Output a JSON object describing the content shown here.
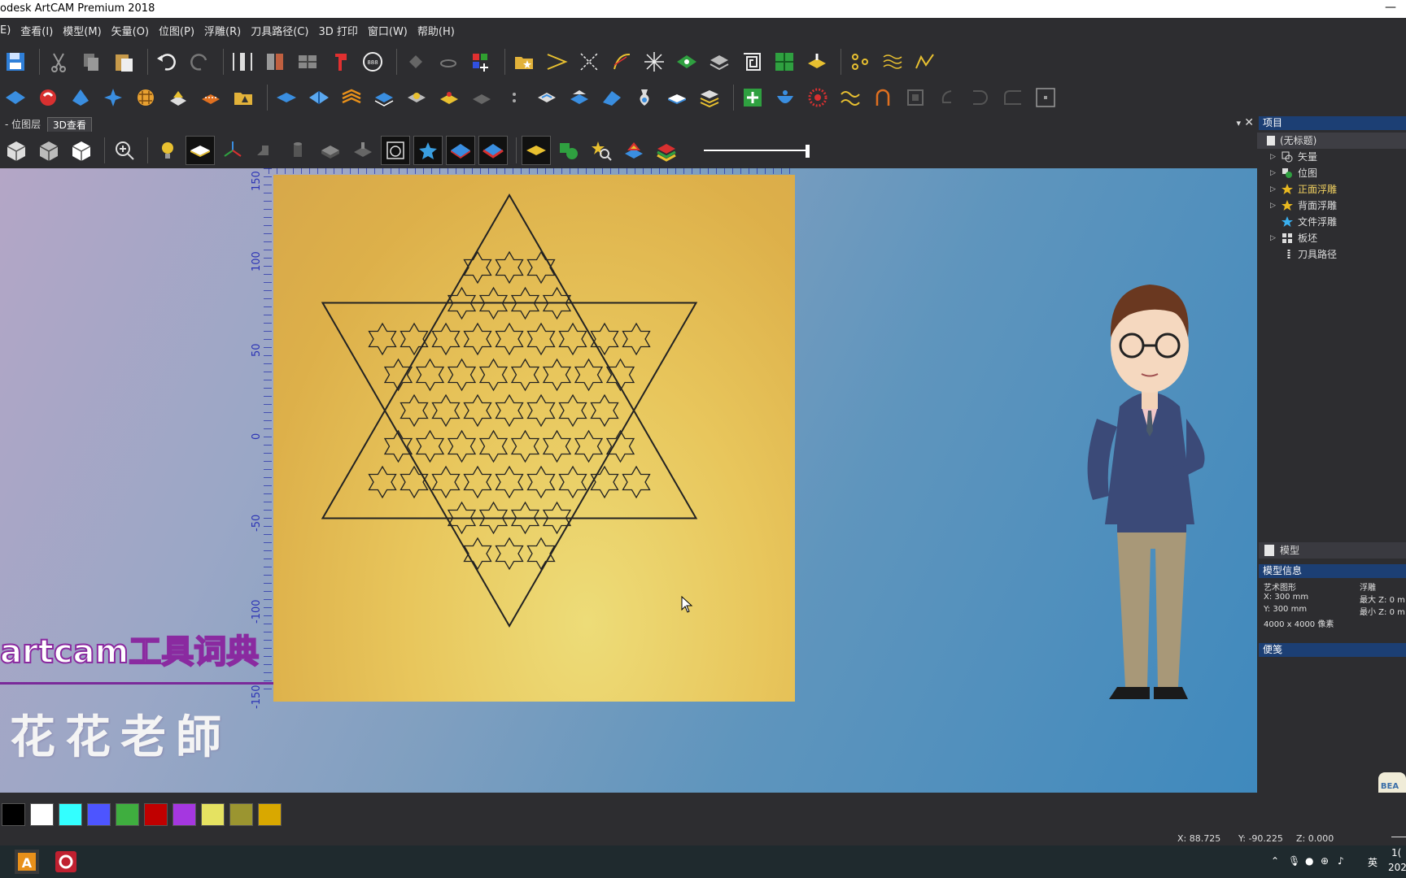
{
  "window": {
    "title": "odesk ArtCAM Premium 2018",
    "minimize": "—"
  },
  "menu": [
    {
      "label": "E)"
    },
    {
      "label": "查看(I)"
    },
    {
      "label": "模型(M)"
    },
    {
      "label": "矢量(O)"
    },
    {
      "label": "位图(P)"
    },
    {
      "label": "浮雕(R)"
    },
    {
      "label": "刀具路径(C)"
    },
    {
      "label": "3D 打印"
    },
    {
      "label": "窗口(W)"
    },
    {
      "label": "帮助(H)"
    }
  ],
  "tabs": {
    "bitmap_layer": "- 位图层",
    "view3d": "3D查看",
    "dropdown": "▾",
    "close": "✕"
  },
  "viewport": {
    "ruler_labels": [
      "150",
      "100",
      "50",
      "0",
      "-50",
      "-100",
      "-150"
    ],
    "overlay_title": "artcam工具词典",
    "overlay_teacher": "花花老師"
  },
  "project": {
    "header": "项目",
    "root": "(无标题)",
    "items": [
      {
        "label": "矢量",
        "icon": "vector-icon"
      },
      {
        "label": "位图",
        "icon": "bitmap-icon"
      },
      {
        "label": "正面浮雕",
        "icon": "star-gold-icon",
        "highlight": true
      },
      {
        "label": "背面浮雕",
        "icon": "star-gold-icon"
      },
      {
        "label": "文件浮雕",
        "icon": "star-blue-icon"
      },
      {
        "label": "板坯",
        "icon": "block-icon"
      },
      {
        "label": "刀具路径",
        "icon": "toolpath-icon"
      }
    ]
  },
  "model_panel": {
    "title": "模型",
    "info_header": "模型信息",
    "col1_title": "艺术图形",
    "x": "X: 300 mm",
    "y": "Y: 300 mm",
    "pixels": "4000 x 4000 像素",
    "col2_title": "浮雕",
    "max_z": "最大 Z: 0 m",
    "min_z": "最小 Z: 0 m",
    "notes_header": "便笺"
  },
  "palette": [
    "#000000",
    "#ffffff",
    "#33ffff",
    "#4d55ff",
    "#3fae3f",
    "#c00000",
    "#a537e0",
    "#e5e261",
    "#9b9530",
    "#d9a800"
  ],
  "status": {
    "x": "X: 88.725",
    "y": "Y: -90.225",
    "z": "Z: 0.000"
  },
  "taskbar": {
    "ime": "英",
    "clock_top": "1(",
    "clock_bottom": "202"
  }
}
